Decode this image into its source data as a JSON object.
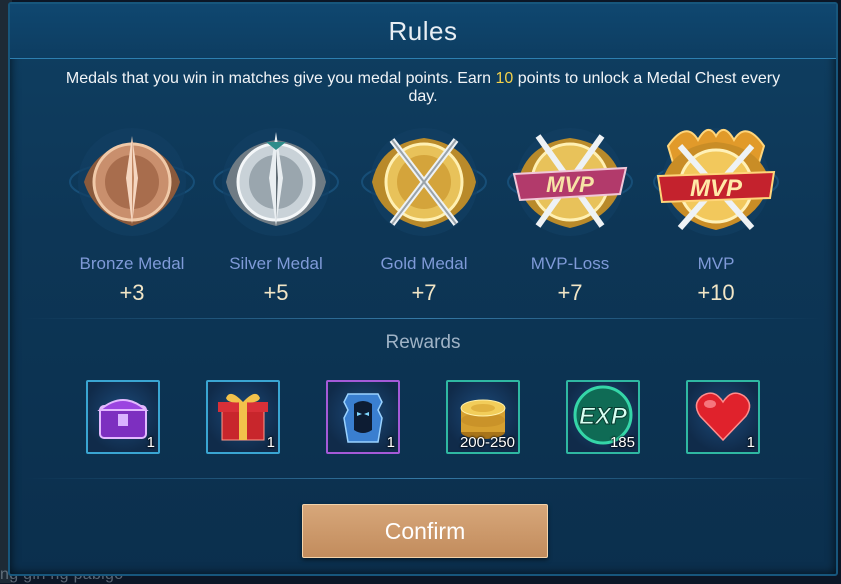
{
  "background": {
    "partial_text": "ng girl ng pabigo"
  },
  "dialog": {
    "title": "Rules",
    "description": {
      "before": "Medals that you win in matches give you medal points. Earn ",
      "highlight": "10",
      "after": " points to unlock a Medal Chest every day."
    },
    "medals": [
      {
        "name": "Bronze Medal",
        "points": "+3",
        "icon": "bronze-medal-icon"
      },
      {
        "name": "Silver Medal",
        "points": "+5",
        "icon": "silver-medal-icon"
      },
      {
        "name": "Gold Medal",
        "points": "+7",
        "icon": "gold-medal-icon"
      },
      {
        "name": "MVP-Loss",
        "points": "+7",
        "icon": "mvp-loss-medal-icon",
        "badge": "MVP"
      },
      {
        "name": "MVP",
        "points": "+10",
        "icon": "mvp-medal-icon",
        "badge": "MVP"
      }
    ],
    "rewards_title": "Rewards",
    "rewards": [
      {
        "icon": "purple-chest-icon",
        "count": "1"
      },
      {
        "icon": "gift-box-icon",
        "count": "1"
      },
      {
        "icon": "skin-fragment-icon",
        "count": "1"
      },
      {
        "icon": "gold-coins-icon",
        "count": "200-250"
      },
      {
        "icon": "exp-icon",
        "count": "185",
        "label": "EXP"
      },
      {
        "icon": "heart-icon",
        "count": "1"
      }
    ],
    "confirm_label": "Confirm"
  },
  "colors": {
    "panel": "#0d3656",
    "medal_name": "#7f9ad8",
    "highlight": "#f4d14a",
    "confirm_button": "#c99463"
  }
}
